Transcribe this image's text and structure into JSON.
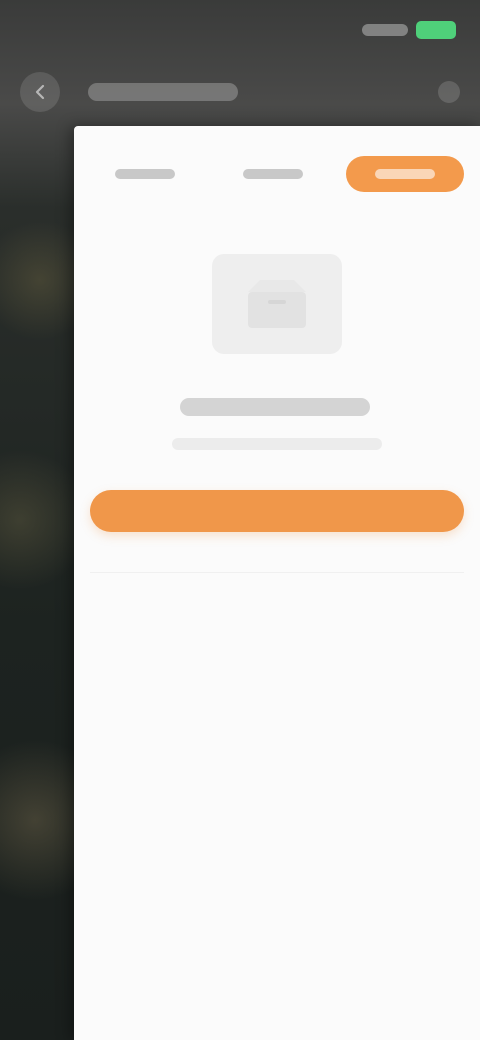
{
  "status_bar": {
    "time": "",
    "icons": [
      "signal-icon",
      "battery-icon"
    ],
    "battery_color": "#4fd07a"
  },
  "toolbar": {
    "back_icon": "back-arrow-icon",
    "title": "",
    "more_icon": "more-icon"
  },
  "sheet": {
    "tabs": [
      {
        "label": ""
      },
      {
        "label": ""
      },
      {
        "label": "",
        "active": true
      }
    ],
    "empty_state": {
      "illustration_icon": "empty-box-icon",
      "title": "",
      "subtitle": ""
    },
    "primary_button": {
      "label": ""
    }
  },
  "colors": {
    "accent": "#f0974a",
    "sheet_background": "#fbfbfb",
    "backdrop": "#1e2522"
  }
}
